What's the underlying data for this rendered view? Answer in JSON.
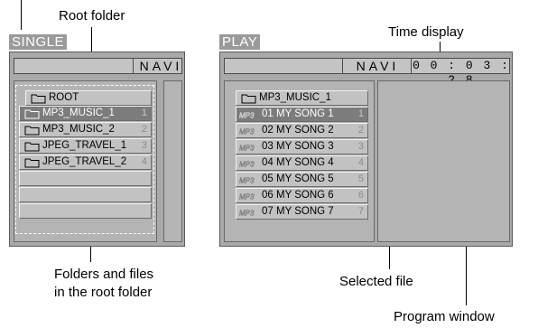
{
  "callouts": {
    "root_folder": "Root folder",
    "time_display": "Time display",
    "folders_files_line1": "Folders and files",
    "folders_files_line2": "in the root folder",
    "selected_file": "Selected file",
    "program_window": "Program window"
  },
  "single_screen": {
    "mode_label": "SINGLE",
    "navi_label": "NAVI",
    "items": [
      {
        "label": "ROOT",
        "number": ""
      },
      {
        "label": "MP3_MUSIC_1",
        "number": "1"
      },
      {
        "label": "MP3_MUSIC_2",
        "number": "2"
      },
      {
        "label": "JPEG_TRAVEL_1",
        "number": "3"
      },
      {
        "label": "JPEG_TRAVEL_2",
        "number": "4"
      }
    ],
    "selected_index": 1
  },
  "play_screen": {
    "mode_label": "PLAY",
    "navi_label": "NAVI",
    "time": "00:03:28",
    "folder": "MP3_MUSIC_1",
    "files": [
      {
        "label": "01 MY SONG 1",
        "number": "1"
      },
      {
        "label": "02 MY SONG 2",
        "number": "2"
      },
      {
        "label": "03 MY SONG 3",
        "number": "3"
      },
      {
        "label": "04 MY SONG 4",
        "number": "4"
      },
      {
        "label": "05 MY SONG 5",
        "number": "5"
      },
      {
        "label": "06 MY SONG 6",
        "number": "6"
      },
      {
        "label": "07 MY SONG 7",
        "number": "7"
      }
    ],
    "selected_index": 0
  },
  "icons": {
    "folder": "folder-icon",
    "mp3": "mp3-file-icon"
  },
  "colors": {
    "screen_bg": "#a9a9a9",
    "row_bg": "#c2c2c2",
    "selected_row_bg": "#7c7c7c",
    "mode_tag_bg": "#9a9a9a"
  }
}
